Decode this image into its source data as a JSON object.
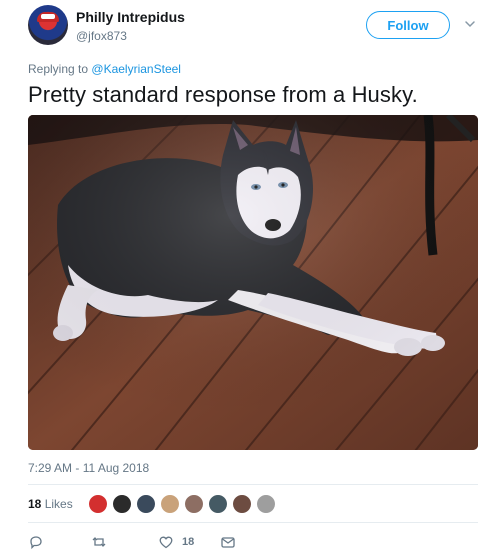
{
  "user": {
    "name": "Philly Intrepidus",
    "handle": "@jfox873"
  },
  "follow_button": {
    "label": "Follow"
  },
  "reply": {
    "prefix": "Replying to",
    "mention": "@KaelyrianSteel"
  },
  "tweet": {
    "text": "Pretty standard response from a Husky.",
    "timestamp": "7:29 AM - 11 Aug 2018"
  },
  "stats": {
    "likes_number": "18",
    "likes_word": "Likes",
    "liker_colors": [
      "#d32f2f",
      "#2b2b2b",
      "#3a4a5c",
      "#c9a27a",
      "#8d6e63",
      "#455a64",
      "#6d4c41",
      "#9e9e9e"
    ]
  },
  "actions": {
    "like_count": "18"
  },
  "colors": {
    "accent": "#1da1f2",
    "secondary_text": "#657786"
  }
}
